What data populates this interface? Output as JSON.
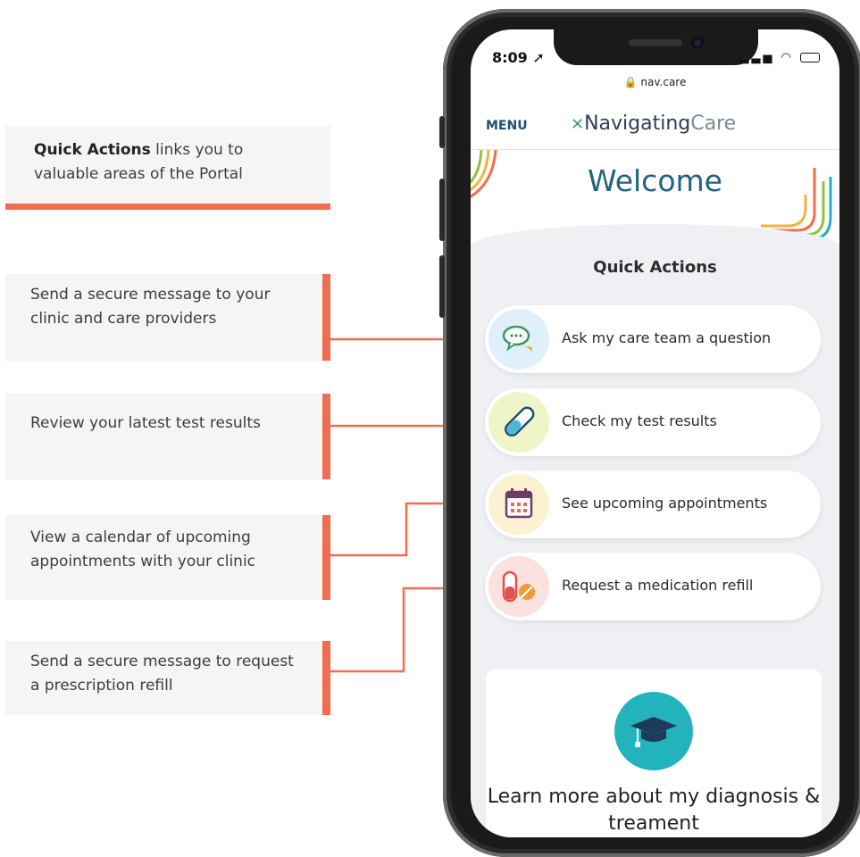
{
  "callouts": {
    "intro_bold": "Quick Actions",
    "intro_rest": " links you to valuable areas of the Portal",
    "ask": "Send a secure message to your clinic and care providers",
    "results": "Review your latest test results",
    "appointments": "View a calendar of upcoming appointments with your clinic",
    "refill": "Send a secure message to request a prescription refill"
  },
  "phone": {
    "status_time": "8:09",
    "url": "nav.care",
    "menu": "MENU",
    "logo_navigating": "Navigating",
    "logo_care": "Care",
    "welcome": "Welcome",
    "quick_actions_title": "Quick Actions",
    "actions": [
      {
        "label": "Ask my care team a question",
        "icon": "chat-bubbles-icon",
        "bg": "#dff0fb"
      },
      {
        "label": "Check my test results",
        "icon": "test-tube-icon",
        "bg": "#eef6c9"
      },
      {
        "label": "See upcoming appointments",
        "icon": "calendar-icon",
        "bg": "#fdf0d3"
      },
      {
        "label": "Request a medication refill",
        "icon": "pill-icon",
        "bg": "#fbe2de"
      }
    ],
    "learn_text": "Learn more about my diagnosis & treament"
  },
  "colors": {
    "accent": "#f26d4f",
    "brand": "#216184",
    "teal": "#22b3bd"
  }
}
